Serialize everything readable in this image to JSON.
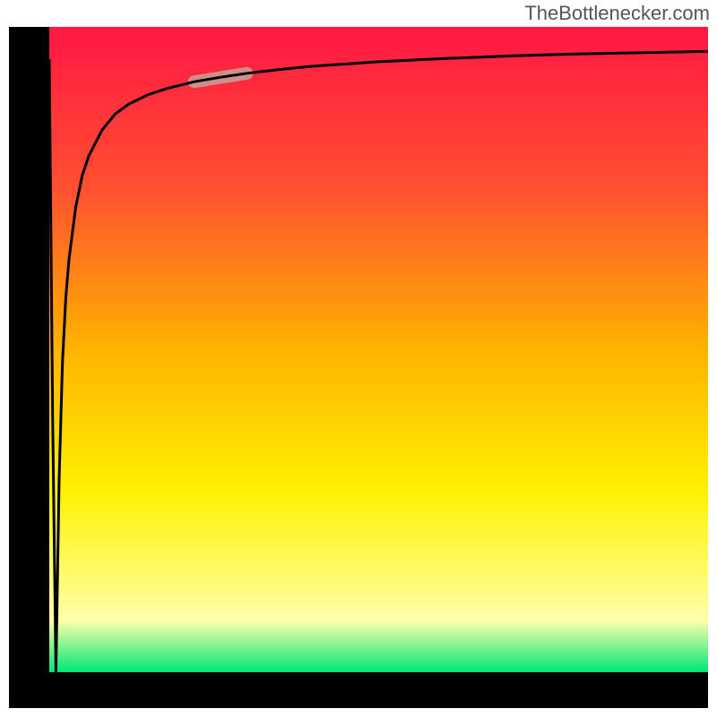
{
  "attribution": "TheBottlenecker.com",
  "colors": {
    "frame": "#000000",
    "curve": "#000000",
    "highlight": "#cc8f8a",
    "gradient_top": "#ff1744",
    "gradient_upper": "#ff5030",
    "gradient_mid": "#ffb300",
    "gradient_lower": "#fff200",
    "gradient_pale": "#ffffaa",
    "gradient_bottom": "#00e676"
  },
  "chart_data": {
    "type": "line",
    "title": "",
    "xlabel": "",
    "ylabel": "",
    "xlim": [
      0,
      100
    ],
    "ylim": [
      0,
      100
    ],
    "series": [
      {
        "name": "curve",
        "x": [
          0,
          0.5,
          1,
          1.5,
          2,
          2.5,
          3,
          4,
          5,
          6,
          8,
          10,
          12,
          15,
          18,
          22,
          26,
          30,
          35,
          40,
          50,
          60,
          70,
          80,
          90,
          100
        ],
        "values": [
          95,
          40,
          0,
          30,
          48,
          58,
          64,
          72,
          77,
          80,
          84,
          86.5,
          88,
          89.5,
          90.5,
          91.5,
          92.2,
          92.8,
          93.4,
          93.9,
          94.6,
          95.1,
          95.5,
          95.8,
          96.0,
          96.2
        ]
      }
    ],
    "highlight_segment": {
      "x_start": 22,
      "x_end": 30,
      "y_start": 91.5,
      "y_end": 92.8
    }
  }
}
